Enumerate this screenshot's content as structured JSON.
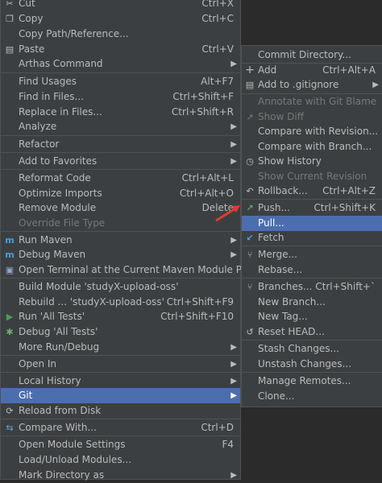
{
  "main_menu": [
    {
      "label": "Cut",
      "shortcut": "Ctrl+X",
      "icon": "scissors-icon",
      "glyph": "✂"
    },
    {
      "label": "Copy",
      "shortcut": "Ctrl+C",
      "icon": "copy-icon",
      "glyph": "❐"
    },
    {
      "label": "Copy Path/Reference...",
      "shortcut": ""
    },
    {
      "label": "Paste",
      "shortcut": "Ctrl+V",
      "icon": "paste-icon",
      "glyph": "📋"
    },
    {
      "label": "Arthas Command",
      "shortcut": ""
    },
    {
      "label": "Find Usages",
      "shortcut": "Alt+F7"
    },
    {
      "label": "Find in Files...",
      "shortcut": "Ctrl+Shift+F"
    },
    {
      "label": "Replace in Files...",
      "shortcut": "Ctrl+Shift+R"
    },
    {
      "label": "Analyze",
      "shortcut": ""
    },
    {
      "label": "Refactor",
      "shortcut": ""
    },
    {
      "label": "Add to Favorites",
      "shortcut": ""
    },
    {
      "label": "Reformat Code",
      "shortcut": "Ctrl+Alt+L"
    },
    {
      "label": "Optimize Imports",
      "shortcut": "Ctrl+Alt+O"
    },
    {
      "label": "Remove Module",
      "shortcut": "Delete"
    },
    {
      "label": "Override File Type",
      "shortcut": ""
    },
    {
      "label": "Run Maven",
      "shortcut": "",
      "icon": "maven-run-icon",
      "glyph": "m"
    },
    {
      "label": "Debug Maven",
      "shortcut": "",
      "icon": "maven-debug-icon",
      "glyph": "m"
    },
    {
      "label": "Open Terminal at the Current Maven Module Path",
      "shortcut": "",
      "icon": "terminal-icon",
      "glyph": "▣"
    },
    {
      "label": "Build Module 'studyX-upload-oss'",
      "shortcut": ""
    },
    {
      "label": "Rebuild ... 'studyX-upload-oss'",
      "shortcut": "Ctrl+Shift+F9"
    },
    {
      "label": "Run 'All Tests'",
      "shortcut": "Ctrl+Shift+F10",
      "icon": "run-icon",
      "glyph": "▶"
    },
    {
      "label": "Debug 'All Tests'",
      "shortcut": "",
      "icon": "debug-icon",
      "glyph": "✱"
    },
    {
      "label": "More Run/Debug",
      "shortcut": ""
    },
    {
      "label": "Open In",
      "shortcut": ""
    },
    {
      "label": "Local History",
      "shortcut": ""
    },
    {
      "label": "Git",
      "shortcut": ""
    },
    {
      "label": "Reload from Disk",
      "shortcut": "",
      "icon": "reload-icon",
      "glyph": "⟳"
    },
    {
      "label": "Compare With...",
      "shortcut": "Ctrl+D",
      "icon": "compare-icon",
      "glyph": "⇆"
    },
    {
      "label": "Open Module Settings",
      "shortcut": "F4"
    },
    {
      "label": "Load/Unload Modules...",
      "shortcut": ""
    },
    {
      "label": "Mark Directory as",
      "shortcut": ""
    }
  ],
  "git_menu": [
    {
      "label": "Commit Directory...",
      "shortcut": ""
    },
    {
      "label": "Add",
      "shortcut": "Ctrl+Alt+A",
      "icon": "plus-icon",
      "glyph": "+"
    },
    {
      "label": "Add to .gitignore",
      "shortcut": "",
      "icon": "gitignore-icon",
      "glyph": "▤"
    },
    {
      "label": "Annotate with Git Blame",
      "shortcut": ""
    },
    {
      "label": "Show Diff",
      "shortcut": "",
      "icon": "diff-icon",
      "glyph": "↗"
    },
    {
      "label": "Compare with Revision...",
      "shortcut": ""
    },
    {
      "label": "Compare with Branch...",
      "shortcut": ""
    },
    {
      "label": "Show History",
      "shortcut": "",
      "icon": "history-icon",
      "glyph": "◷"
    },
    {
      "label": "Show Current Revision",
      "shortcut": ""
    },
    {
      "label": "Rollback...",
      "shortcut": "Ctrl+Alt+Z",
      "icon": "rollback-icon",
      "glyph": "↶"
    },
    {
      "label": "Push...",
      "shortcut": "Ctrl+Shift+K",
      "icon": "push-icon",
      "glyph": "↗"
    },
    {
      "label": "Pull...",
      "shortcut": ""
    },
    {
      "label": "Fetch",
      "shortcut": "",
      "icon": "fetch-icon",
      "glyph": "↙"
    },
    {
      "label": "Merge...",
      "shortcut": "",
      "icon": "merge-icon",
      "glyph": "⑂"
    },
    {
      "label": "Rebase...",
      "shortcut": ""
    },
    {
      "label": "Branches...",
      "shortcut": "Ctrl+Shift+`",
      "icon": "branch-icon",
      "glyph": "⑂"
    },
    {
      "label": "New Branch...",
      "shortcut": ""
    },
    {
      "label": "New Tag...",
      "shortcut": ""
    },
    {
      "label": "Reset HEAD...",
      "shortcut": "",
      "icon": "reset-icon",
      "glyph": "↺"
    },
    {
      "label": "Stash Changes...",
      "shortcut": ""
    },
    {
      "label": "Unstash Changes...",
      "shortcut": ""
    },
    {
      "label": "Manage Remotes...",
      "shortcut": ""
    },
    {
      "label": "Clone...",
      "shortcut": ""
    }
  ],
  "colors": {
    "menu_bg": "#3c3f41",
    "selected": "#4b6eaf",
    "text": "#bbbbbb",
    "disabled": "#777777",
    "arrow_annotation": "#e03c31"
  }
}
